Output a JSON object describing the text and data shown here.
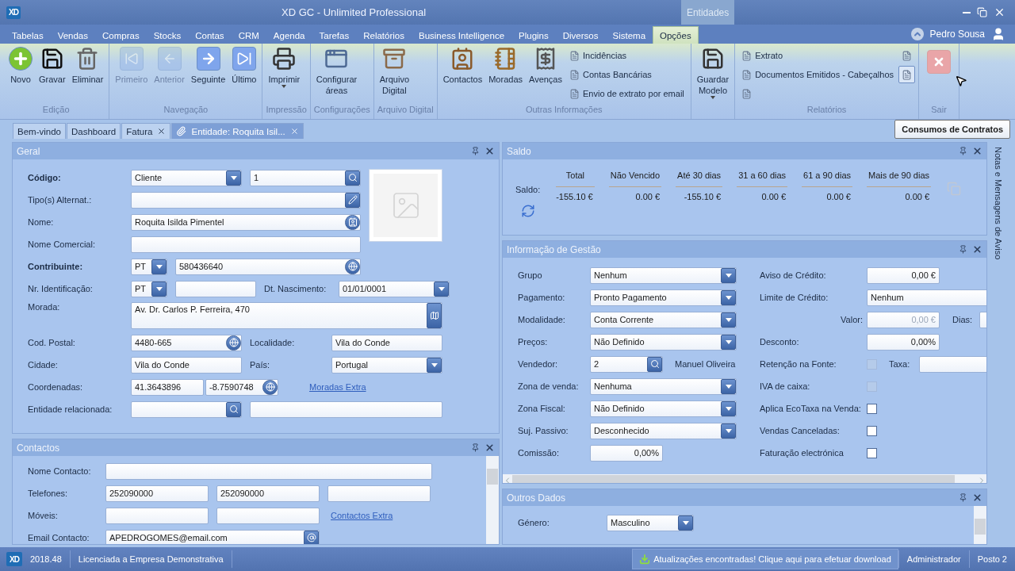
{
  "title_bar": {
    "logo": "XD",
    "title": "XD GC - Unlimited Professional",
    "context": "Entidades"
  },
  "menu": {
    "tabs": [
      {
        "label": "Tabelas",
        "selected": false
      },
      {
        "label": "Vendas",
        "selected": false
      },
      {
        "label": "Compras",
        "selected": false
      },
      {
        "label": "Stocks",
        "selected": false
      },
      {
        "label": "Contas",
        "selected": false
      },
      {
        "label": "CRM",
        "selected": false
      },
      {
        "label": "Agenda",
        "selected": false
      },
      {
        "label": "Tarefas",
        "selected": false
      },
      {
        "label": "Relatórios",
        "selected": false
      },
      {
        "label": "Business Intelligence",
        "selected": false
      },
      {
        "label": "Plugins",
        "selected": false
      },
      {
        "label": "Diversos",
        "selected": false
      },
      {
        "label": "Sistema",
        "selected": false
      },
      {
        "label": "Opções",
        "selected": true
      }
    ],
    "user": "Pedro Sousa"
  },
  "ribbon": {
    "groups": [
      {
        "label": "Edição",
        "items": [
          {
            "kind": "large",
            "label": "Novo",
            "disabled": false
          },
          {
            "kind": "large",
            "label": "Gravar",
            "disabled": false
          },
          {
            "kind": "large",
            "label": "Eliminar",
            "disabled": false
          }
        ]
      },
      {
        "label": "Navegação",
        "items": [
          {
            "kind": "large",
            "label": "Primeiro",
            "disabled": true
          },
          {
            "kind": "large",
            "label": "Anterior",
            "disabled": true
          },
          {
            "kind": "large",
            "label": "Seguinte",
            "disabled": false
          },
          {
            "kind": "large",
            "label": "Último",
            "disabled": false
          }
        ]
      },
      {
        "label": "Impressão",
        "items": [
          {
            "kind": "large",
            "label": "Imprimir",
            "disabled": false,
            "dropdown": true
          }
        ]
      },
      {
        "label": "Configurações",
        "items": [
          {
            "kind": "large",
            "label": "Configurar\náreas",
            "disabled": false
          }
        ]
      },
      {
        "label": "Arquivo Digital",
        "items": [
          {
            "kind": "large",
            "label": "Arquivo\nDigital",
            "disabled": false
          }
        ]
      },
      {
        "label": "Outras Informações",
        "items": [
          {
            "kind": "large",
            "label": "Contactos",
            "disabled": false
          },
          {
            "kind": "large",
            "label": "Moradas",
            "disabled": false
          },
          {
            "kind": "large",
            "label": "Avenças",
            "disabled": false
          },
          {
            "kind": "small",
            "label": "Incidências"
          },
          {
            "kind": "small",
            "label": "Contas Bancárias"
          },
          {
            "kind": "small",
            "label": "Envio de extrato por email"
          }
        ]
      },
      {
        "items": [
          {
            "kind": "large",
            "label": "Guardar\nModelo",
            "disabled": false,
            "dropdown": true
          }
        ]
      },
      {
        "label": "Relatórios",
        "items": [
          {
            "kind": "small",
            "label": "Extrato",
            "hovered": false
          },
          {
            "kind": "small",
            "label": "Documentos Emitidos - Cabeçalhos",
            "hovered": false
          },
          {
            "kind": "small",
            "hovered": false
          },
          {
            "kind": "small",
            "hovered": false
          },
          {
            "kind": "small",
            "hovered": true
          }
        ]
      },
      {
        "label": "Sair",
        "items": [
          {
            "kind": "exit"
          }
        ]
      }
    ]
  },
  "doc_tabs": [
    {
      "label": "Bem-vindo",
      "closable": false,
      "selected": false
    },
    {
      "label": "Dashboard",
      "closable": false,
      "selected": false
    },
    {
      "label": "Fatura",
      "closable": true,
      "selected": false
    },
    {
      "label": "Entidade: Roquita Isil...",
      "closable": true,
      "selected": true
    }
  ],
  "tooltip": "Consumos de Contratos",
  "geral": {
    "title": "Geral",
    "codigo": {
      "label": "Código:",
      "required": true,
      "type": "Cliente",
      "value": "1"
    },
    "tipos_alternat": {
      "label": "Tipo(s) Alternat.:",
      "required": false
    },
    "nome": {
      "label": "Nome:",
      "required": false,
      "value": "Roquita Isilda Pimentel"
    },
    "nome_comercial": {
      "label": "Nome Comercial:",
      "required": false
    },
    "contribuinte": {
      "label": "Contribuinte:",
      "required": true,
      "country": "PT",
      "value": "580436640"
    },
    "nr_identificacao": {
      "label": "Nr. Identificação:",
      "required": false,
      "country": "PT"
    },
    "dt_nascimento": {
      "label": "Dt. Nascimento:",
      "value": "01/01/0001"
    },
    "morada": {
      "label": "Morada:",
      "required": false,
      "value": "Av. Dr. Carlos P. Ferreira, 470"
    },
    "cod_postal": {
      "label": "Cod. Postal:",
      "required": false,
      "value": "4480-665"
    },
    "localidade": {
      "label": "Localidade:",
      "value": "Vila do Conde"
    },
    "cidade": {
      "label": "Cidade:",
      "required": false,
      "value": "Vila do Conde"
    },
    "pais": {
      "label": "País:",
      "value": "Portugal"
    },
    "coordenadas": {
      "label": "Coordenadas:",
      "required": false,
      "latitude": "41.3643896",
      "longitude": "-8.7590748"
    },
    "moradas_extra": "Moradas Extra",
    "entidade_relacionada": {
      "label": "Entidade relacionada:",
      "required": false
    }
  },
  "contactos": {
    "title": "Contactos",
    "nome_contacto": {
      "label": "Nome Contacto:"
    },
    "telefones": {
      "label": "Telefones:",
      "values": [
        "252090000",
        "252090000"
      ]
    },
    "moveis": {
      "label": "Móveis:",
      "link": "Contactos Extra"
    },
    "email": {
      "label": "Email Contacto:",
      "value": "APEDROGOMES@email.com"
    }
  },
  "saldo": {
    "title": "Saldo",
    "label": "Saldo:",
    "columns": [
      "Total",
      "Não Vencido",
      "Até 30 dias",
      "31 a 60 dias",
      "61 a 90 dias",
      "Mais de 90 dias"
    ],
    "values": [
      "-155.10 €",
      "0.00 €",
      "-155.10 €",
      "0.00 €",
      "0.00 €",
      "0.00 €"
    ]
  },
  "gestao": {
    "title": "Informação de Gestão",
    "left": [
      {
        "kind": "combo",
        "label": "Grupo",
        "value": "Nenhum"
      },
      {
        "kind": "combo",
        "label": "Pagamento:",
        "value": "Pronto Pagamento"
      },
      {
        "kind": "combo",
        "label": "Modalidade:",
        "value": "Conta Corrente"
      },
      {
        "kind": "combo",
        "label": "Preços:",
        "value": "Não Definido"
      },
      {
        "kind": "search",
        "label": "Vendedor:",
        "value": "2",
        "name": "Manuel Oliveira"
      },
      {
        "kind": "combo",
        "label": "Zona de venda:",
        "value": "Nenhuma"
      },
      {
        "kind": "combo",
        "label": "Zona Fiscal:",
        "value": "Não Definido"
      },
      {
        "kind": "combo",
        "label": "Suj. Passivo:",
        "value": "Desconhecido"
      },
      {
        "kind": "amount",
        "label": "Comissão:",
        "value": "0,00%"
      }
    ],
    "right": [
      {
        "kind": "amount",
        "label": "Aviso de Crédito:",
        "value": "0,00 €"
      },
      {
        "kind": "text",
        "label": "Limite de Crédito:",
        "value": "Nenhum"
      },
      {
        "kind": "valor",
        "label": "Valor:",
        "value": "0,00 €",
        "extra_label": "Dias:"
      },
      {
        "kind": "amount",
        "label": "Desconto:",
        "value": "0,00%"
      },
      {
        "kind": "check",
        "label": "Retenção na Fonte:",
        "checked": false,
        "disabled": true,
        "extra_label": "Taxa:"
      },
      {
        "kind": "check",
        "label": "IVA de caixa:",
        "checked": false,
        "disabled": true
      },
      {
        "kind": "check",
        "label": "Aplica EcoTaxa na Venda:",
        "checked": false,
        "disabled": false
      },
      {
        "kind": "check",
        "label": "Vendas Canceladas:",
        "checked": false,
        "disabled": false
      },
      {
        "kind": "check",
        "label": "Faturação electrónica",
        "checked": false,
        "disabled": false
      }
    ]
  },
  "outros": {
    "title": "Outros Dados",
    "genero": {
      "label": "Género:",
      "value": "Masculino"
    }
  },
  "side_panel": "Notas e Mensagens de Aviso",
  "status_bar": {
    "logo": "XD",
    "version": "2018.48",
    "license": "Licenciada a Empresa Demonstrativa",
    "update": "Atualizações encontradas! Clique aqui para efetuar download",
    "user": "Administrador",
    "station": "Posto 2"
  }
}
